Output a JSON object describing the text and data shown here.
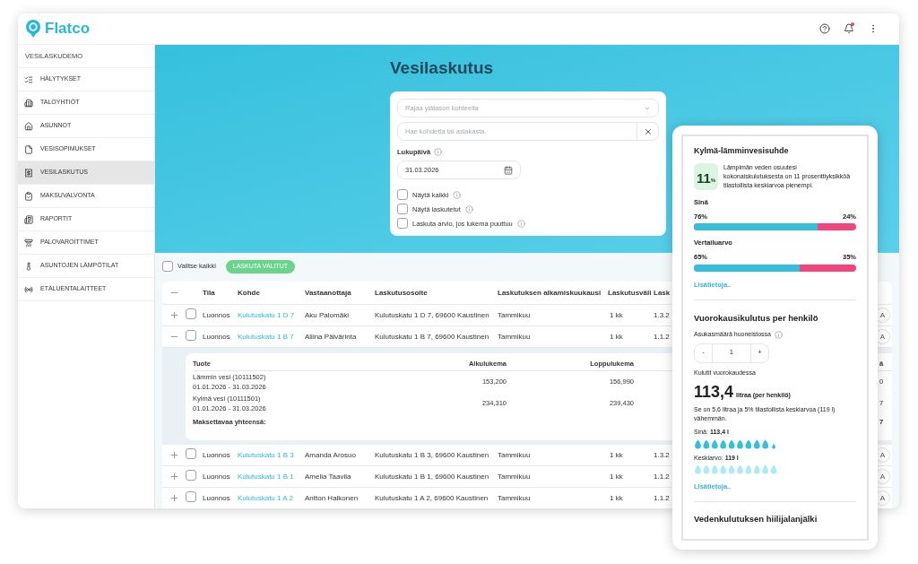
{
  "app": {
    "logo": "Flatco"
  },
  "sidebar": {
    "org": "VESILASKUDEMO",
    "items": [
      {
        "label": "HÄLYTYKSET",
        "selected": false
      },
      {
        "label": "TALOYHTIÖT",
        "selected": false
      },
      {
        "label": "ASUNNOT",
        "selected": false
      },
      {
        "label": "VESISOPIMUKSET",
        "selected": false
      },
      {
        "label": "VESILASKUTUS",
        "selected": true
      },
      {
        "label": "MAKSUVALVONTA",
        "selected": false
      },
      {
        "label": "RAPORTIT",
        "selected": false
      },
      {
        "label": "PALOVAROITTIMET",
        "selected": false
      },
      {
        "label": "ASUNTOJEN LÄMPÖTILAT",
        "selected": false
      },
      {
        "label": "ETÄLUENTALAITTEET",
        "selected": false
      }
    ]
  },
  "hero": {
    "title": "Vesilaskutus"
  },
  "filters": {
    "parent_select": {
      "placeholder": "Rajaa ylätason kohteella"
    },
    "search": {
      "placeholder": "Hae kohdetta tai asiakasta."
    },
    "date": {
      "label": "Lukupäivä",
      "value": "31.03.2026"
    },
    "options": [
      {
        "label": "Näytä kaikki",
        "checked": false
      },
      {
        "label": "Näytä laskutetut",
        "checked": false
      },
      {
        "label": "Laskuta arvio, jos lukema puuttuu",
        "checked": false
      }
    ]
  },
  "toolbar": {
    "select_all": {
      "label": "Valitse kaikki",
      "checked": false
    },
    "bill_button": "LASKUTA VALITUT"
  },
  "table": {
    "columns": [
      "Tila",
      "Kohde",
      "Vastaanottaja",
      "Laskutusosoite",
      "Laskutuksen alkamiskuukausi",
      "Laskutusväli",
      "Lask"
    ],
    "rows": [
      {
        "expanded": false,
        "checked": false,
        "cells": [
          "Luonnos",
          "Kulutuskatu 1 D 7",
          "Aku Palomäki",
          "Kulutuskatu 1 D 7, 69600 Kaustinen",
          "Tammikuu",
          "1 kk",
          "1.3.2"
        ],
        "column_end": "A"
      },
      {
        "expanded": true,
        "checked": false,
        "cells": [
          "Luonnos",
          "Kulutuskatu 1 B 7",
          "Aliina Päivärinta",
          "Kulutuskatu 1 B 7, 69600 Kaustinen",
          "Tammikuu",
          "1 kk",
          "1.1.2"
        ],
        "column_end": "A",
        "details": {
          "columns": [
            "Tuote",
            "Alkulukema",
            "Loppulukema"
          ],
          "column_end": "ä",
          "items": [
            {
              "product": "Lämmin vesi (10111502)",
              "period": "01.01.2026 - 31.03.2026",
              "start": "153,200",
              "end": "156,990",
              "column_end": "0"
            },
            {
              "product": "Kylmä vesi (10111501)",
              "period": "01.01.2026 - 31.03.2026",
              "start": "234,310",
              "end": "239,430",
              "column_end": "7"
            }
          ],
          "total_label": "Maksettavaa yhteensä:",
          "total_column_end": "7"
        }
      },
      {
        "expanded": false,
        "checked": false,
        "cells": [
          "Luonnos",
          "Kulutuskatu 1 B 3",
          "Amanda Arosuo",
          "Kulutuskatu 1 B 3, 69600 Kaustinen",
          "Tammikuu",
          "1 kk",
          "1.3.2"
        ],
        "column_end": "A"
      },
      {
        "expanded": false,
        "checked": false,
        "cells": [
          "Luonnos",
          "Kulutuskatu 1 B 1",
          "Amelia Taavila",
          "Kulutuskatu 1 B 1, 69600 Kaustinen",
          "Tammikuu",
          "1 kk",
          "1.1.2"
        ],
        "column_end": "A"
      },
      {
        "expanded": false,
        "checked": false,
        "cells": [
          "Luonnos",
          "Kulutuskatu 1 A 2",
          "Antton Halkonen",
          "Kulutuskatu 1 A 2, 69600 Kaustinen",
          "Tammikuu",
          "1 kk",
          "1.1.2"
        ],
        "column_end": "A"
      }
    ]
  },
  "panel": {
    "ratio": {
      "title": "Kylmä-lämminvesisuhde",
      "badge_value": "11",
      "badge_unit": "%",
      "text": "Lämpimän veden osuutesi kokonaiskulutuksesta on 11 prosenttiyksikköä tilastollista keskiarvoa pienempi.",
      "bars": [
        {
          "label": "Sinä",
          "cold": "76%",
          "warm": "24%",
          "level": 0.76
        },
        {
          "label": "Vertailuarvo",
          "cold": "65%",
          "warm": "35%",
          "level": 0.65
        }
      ],
      "link": "Lisätietoja.."
    },
    "daily": {
      "title": "Vuorokausikulutus per henkilö",
      "residents_label": "Asukasmäärä huoneistossa",
      "stepper": {
        "minus": "-",
        "value": "1",
        "plus": "+"
      },
      "caption": "Kulutit vuorokaudessa",
      "amount": "113,4",
      "unit": "litraa (per henkilö)",
      "text": "Se on 5,6 litraa ja 5% tilastollista keskiarvoa (119 l) vähemmän.",
      "drop_rows": [
        {
          "kind": "you",
          "label": "Sinä: **113,4 l**"
        },
        {
          "kind": "average",
          "label": "Keskiarvo: **119 l**"
        }
      ],
      "link": "Lisätietoja.."
    },
    "carbon": {
      "title": "Vedenkulutuksen hiilijalanjälki"
    }
  }
}
